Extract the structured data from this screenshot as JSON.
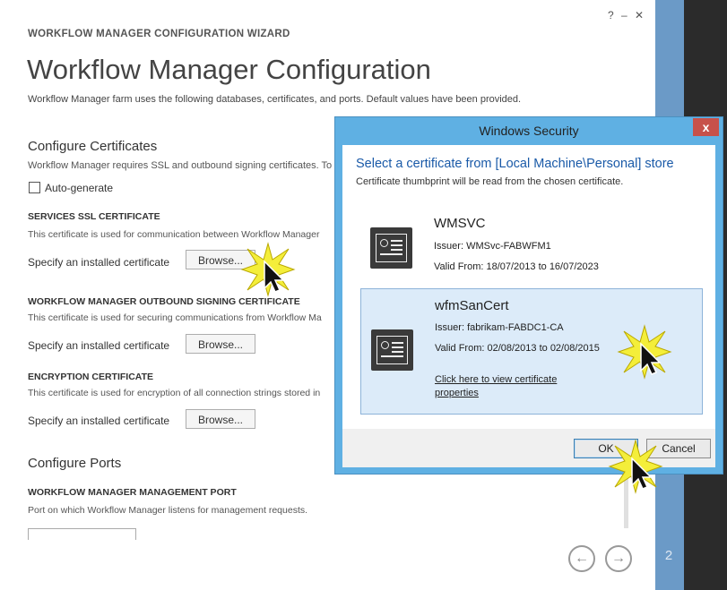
{
  "window": {
    "help": "?",
    "minimize": "–",
    "close": "✕"
  },
  "wizard": {
    "breadcrumb": "WORKFLOW MANAGER CONFIGURATION WIZARD",
    "title": "Workflow Manager Configuration",
    "description": "Workflow Manager farm uses the following databases, certificates, and ports. Default values have been provided.",
    "certs_heading": "Configure Certificates",
    "certs_desc": "Workflow Manager requires SSL and outbound signing certificates. To",
    "auto_generate": "Auto-generate",
    "ssl": {
      "title": "SERVICES SSL CERTIFICATE",
      "desc": "This certificate is used for communication between Workflow Manager",
      "label": "Specify an installed certificate",
      "button": "Browse..."
    },
    "signing": {
      "title": "WORKFLOW MANAGER OUTBOUND SIGNING CERTIFICATE",
      "desc": "This certificate is used for securing communications from Workflow Ma",
      "label": "Specify an installed certificate",
      "button": "Browse..."
    },
    "encryption": {
      "title": "ENCRYPTION CERTIFICATE",
      "desc": "This certificate is used for encryption of all connection strings stored in",
      "label": "Specify an installed certificate",
      "button": "Browse..."
    },
    "ports_heading": "Configure Ports",
    "mgmt_port": {
      "title": "WORKFLOW MANAGER MANAGEMENT PORT",
      "desc": "Port on which Workflow Manager listens for management requests."
    },
    "nav_back": "←",
    "nav_next": "→",
    "page_number": "2"
  },
  "dialog": {
    "title": "Windows Security",
    "close": "x",
    "heading": "Select a certificate from [Local Machine\\Personal] store",
    "subheading": "Certificate thumbprint will be read from the chosen certificate.",
    "certificates": [
      {
        "name": "WMSVC",
        "issuer": "Issuer: WMSvc-FABWFM1",
        "valid": "Valid From: 18/07/2013 to 16/07/2023"
      },
      {
        "name": "wfmSanCert",
        "issuer": "Issuer: fabrikam-FABDC1-CA",
        "valid": "Valid From: 02/08/2013 to 02/08/2015",
        "link": "Click here to view certificate properties"
      }
    ],
    "ok": "OK",
    "cancel": "Cancel"
  },
  "icons": [
    "certificate-icon",
    "cursor-icon",
    "click-burst-icon",
    "back-arrow-icon",
    "next-arrow-icon"
  ],
  "colors": {
    "dialog_frame": "#5fb0e3",
    "heading_blue": "#1a5aa8",
    "selected_bg": "#dcebf9",
    "close_red": "#c7514a",
    "burst_yellow": "#f4ee3a"
  }
}
